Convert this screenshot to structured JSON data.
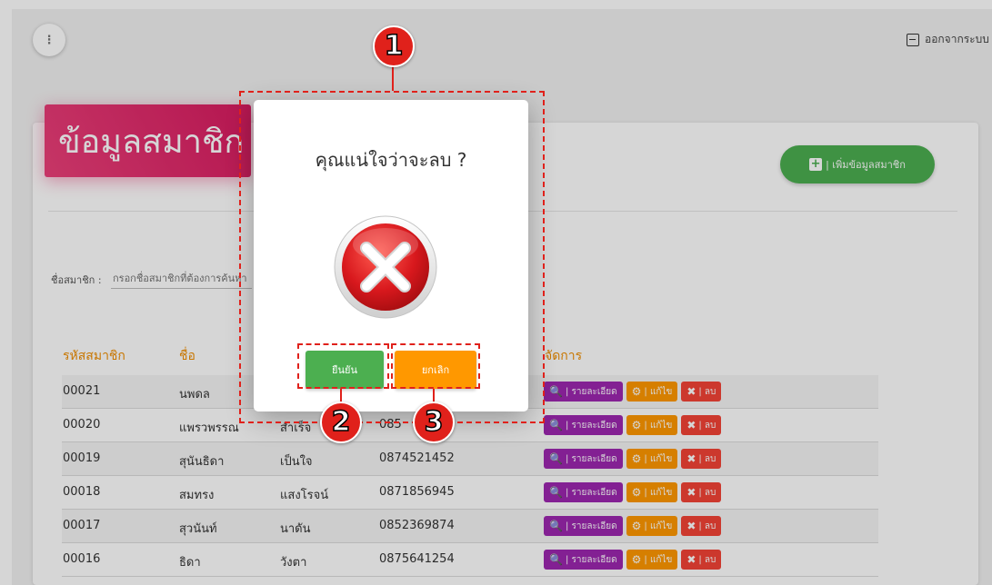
{
  "topbar": {
    "menu_icon": "more-vert-icon",
    "logout_label": "ออกจากระบบ",
    "logout_icon": "logout-icon"
  },
  "card": {
    "title": "ข้อมูลสมาชิก",
    "add_button": "| เพิ่มข้อมูลสมาชิก",
    "add_icon": "plus-square-icon"
  },
  "search": {
    "label": "ชื่อสมาชิก :",
    "placeholder": "กรอกชื่อสมาชิกที่ต้องการค้นหา"
  },
  "table": {
    "headers": [
      "รหัสสมาชิก",
      "ชื่อ",
      "จัดการ"
    ],
    "rows": [
      {
        "id": "00021",
        "first_name": "นพดล",
        "last_name": "",
        "phone": ""
      },
      {
        "id": "00020",
        "first_name": "แพรวพรรณ",
        "last_name": "สำเร็จ",
        "phone": "085"
      },
      {
        "id": "00019",
        "first_name": "สุนันธิดา",
        "last_name": "เป็นใจ",
        "phone": "0874521452"
      },
      {
        "id": "00018",
        "first_name": "สมทรง",
        "last_name": "แสงโรจน์",
        "phone": "0871856945"
      },
      {
        "id": "00017",
        "first_name": "สุวนันท์",
        "last_name": "นาดัน",
        "phone": "0852369874"
      },
      {
        "id": "00016",
        "first_name": "ธิดา",
        "last_name": "วังตา",
        "phone": "0875641254"
      }
    ],
    "actions": {
      "detail": "| รายละเอียด",
      "edit": "| แก้ไข",
      "delete": "| ลบ"
    }
  },
  "dialog": {
    "title": "คุณแน่ใจว่าจะลบ ?",
    "icon": "error-x-icon",
    "confirm": "ยืนยัน",
    "cancel": "ยกเลิก"
  },
  "callouts": [
    "1",
    "2",
    "3"
  ],
  "colors": {
    "pink": "#d81b60",
    "green": "#4caf50",
    "orange": "#ff9800",
    "purple": "#9c27b0",
    "red": "#f44336",
    "annotation": "#e0211b"
  }
}
